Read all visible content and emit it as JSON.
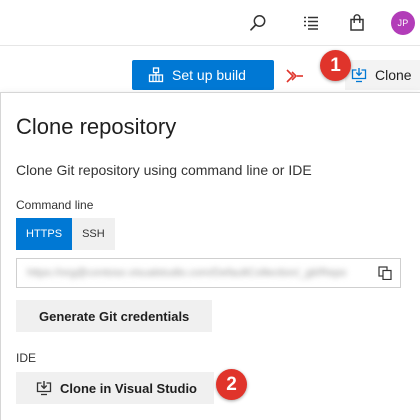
{
  "header": {
    "avatar_initials": "JP",
    "icons": [
      "search-icon",
      "task-list-icon",
      "shopping-bag-icon"
    ]
  },
  "toolbar": {
    "setup_build_label": "Set up build",
    "clone_label": "Clone"
  },
  "badges": {
    "step1": "1",
    "step2": "2"
  },
  "panel": {
    "title": "Clone repository",
    "description": "Clone Git repository using command line or IDE",
    "command_line_label": "Command line",
    "tabs": [
      {
        "label": "HTTPS",
        "active": true
      },
      {
        "label": "SSH",
        "active": false
      }
    ],
    "url_value": "https://org@contoso.visualstudio.com/DefaultCollection/_git/Repo",
    "generate_credentials_label": "Generate Git credentials",
    "ide_label": "IDE",
    "clone_vs_label": "Clone in Visual Studio"
  },
  "colors": {
    "accent": "#0078d4",
    "badge": "#e0342b",
    "avatar": "#b23cb8",
    "pr_icon": "#e0342b"
  }
}
